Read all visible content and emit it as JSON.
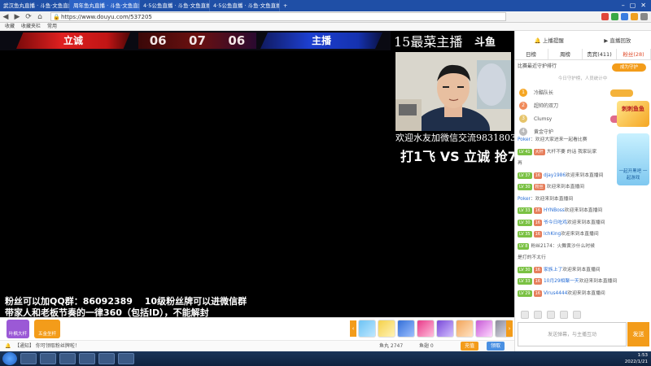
{
  "browser": {
    "tabs": [
      {
        "label": "武汉鱼丸直播 · 斗鱼·文鱼直播",
        "active": false
      },
      {
        "label": "周年鱼丸直播 · 斗鱼·文鱼直播",
        "active": true
      },
      {
        "label": "4·5公鱼直播 · 斗鱼·文鱼直播",
        "active": false
      },
      {
        "label": "4·5公鱼直播 · 斗鱼·文鱼直播",
        "active": false
      }
    ],
    "url": "https://www.douyu.com/537205",
    "bookmarks": [
      "收藏",
      "收藏夹栏",
      "常用"
    ]
  },
  "stream": {
    "team_left": "立诚",
    "team_right": "主播",
    "timer": [
      "06",
      "07",
      "06"
    ],
    "title": "15最菜主播",
    "logo": "斗鱼",
    "wechat_text": "欢迎水友加微信交流9831803",
    "match_text": "打1飞 VS 立诚 抢7",
    "caption_line1": "粉丝可以加QQ群：86092389　 10级粉丝牌可以进微信群",
    "caption_line2": "带家人和老板节奏的一律360（包括ID），不能解封"
  },
  "gift_bar": {
    "btn1": "叶枫大杆",
    "btn2": "五金坐杆",
    "info": "【通知】 你可领取粉丝牌啦！",
    "info_right": [
      "鱼丸 2747",
      "鱼翅 0",
      "充值",
      "领取"
    ]
  },
  "right_panel": {
    "top_links": [
      "上播提醒",
      "直播回放"
    ],
    "tabs": [
      {
        "label": "日榜",
        "active": false
      },
      {
        "label": "周榜",
        "active": false
      },
      {
        "label": "贵宾(411)",
        "active": false
      },
      {
        "label": "粉丝(28)",
        "active": true
      }
    ],
    "rank_header": "比赛最近守护排行",
    "rank_button": "成为守护",
    "rank_sub": "今日守护榜，人员统计中",
    "ranks": [
      {
        "num": "1",
        "name": "冷酷队长"
      },
      {
        "num": "2",
        "name": "超帅的双刀"
      },
      {
        "num": "3",
        "name": "Clumsy"
      },
      {
        "num": "4",
        "name": "黄金守护"
      }
    ],
    "chat": [
      {
        "lv": "",
        "medal": "",
        "nick": "Poker",
        "text": "：欢迎大家进来一起看比赛"
      },
      {
        "lv": "LV 41",
        "medal": "大杆",
        "nick": "",
        "text": "大杆不要 的话 我家玩家"
      },
      {
        "lv": "",
        "medal": "",
        "nick": "",
        "text": "再"
      },
      {
        "lv": "LV 37",
        "medal": "16",
        "nick": "djay1986",
        "text": "欢迎来到本直播间"
      },
      {
        "lv": "LV 30",
        "medal": "粉丝",
        "nick": "",
        "text": "欢迎来到本直播间"
      },
      {
        "lv": "",
        "medal": "",
        "nick": "Poker",
        "text": "：欢迎来到本直播间"
      },
      {
        "lv": "LV 33",
        "medal": "16",
        "nick": "HYNBoss",
        "text": "欢迎来到本直播间"
      },
      {
        "lv": "LV 30",
        "medal": "16",
        "nick": "爷今日吃鸡",
        "text": "欢迎来到本直播间"
      },
      {
        "lv": "LV 35",
        "medal": "16",
        "nick": "lchKing",
        "text": "欢迎来到本直播间"
      },
      {
        "lv": "LV 8",
        "medal": "",
        "nick": "",
        "text": "粉丝2174：火舞黄沙什么时候"
      },
      {
        "lv": "",
        "medal": "",
        "nick": "",
        "text": "是打的不太行"
      },
      {
        "lv": "LV 30",
        "medal": "16",
        "nick": "家族上了",
        "text": "欢迎来到本直播间"
      },
      {
        "lv": "LV 33",
        "medal": "16",
        "nick": "10月29相聚一天",
        "text": "欢迎来到本直播间"
      },
      {
        "lv": "LV 29",
        "medal": "16",
        "nick": "Virus4444",
        "text": "欢迎来到本直播间"
      }
    ],
    "side_float": "刺刺鱼鱼",
    "side_float2": "一起开黑吧 一起游戏",
    "msg_placeholder": "发送弹幕，与主播互动",
    "send": "发送"
  },
  "taskbar": {
    "time": "1:53",
    "date": "2022/1/21"
  }
}
